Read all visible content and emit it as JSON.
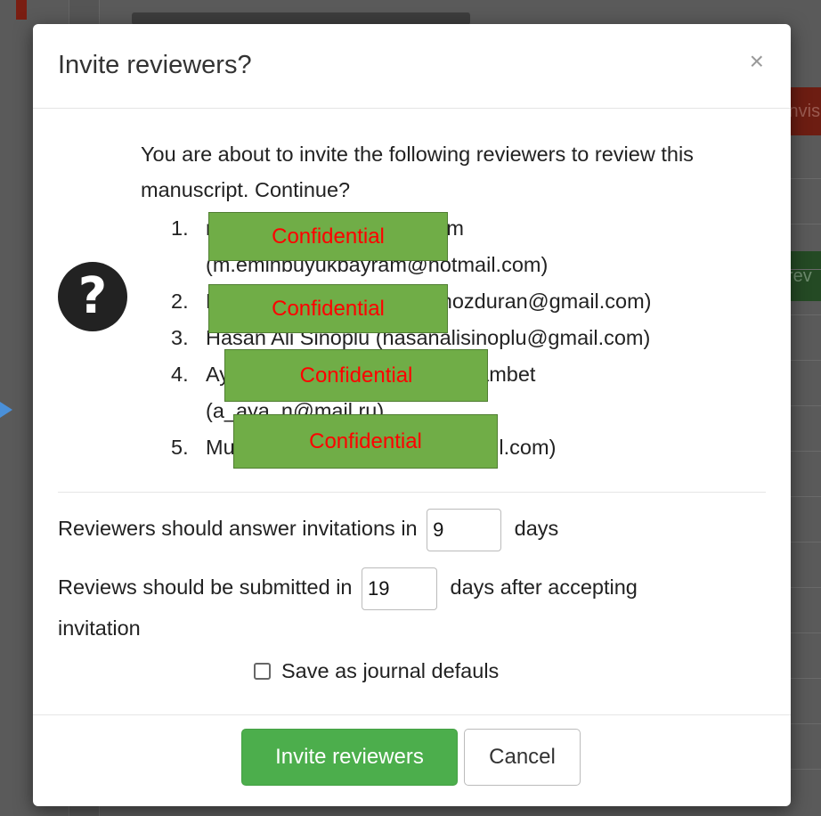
{
  "background": {
    "red_button_label": "Invis",
    "green_button_label": "rev"
  },
  "modal": {
    "title": "Invite reviewers?",
    "close_glyph": "×",
    "question_icon": "question-circle-icon",
    "intro": "You are about to invite the following reviewers to review this manuscript. Continue?",
    "reviewers": [
      {
        "num": "1.",
        "line1": "mehmet emin büyükbayram",
        "line2": "(m.eminbuyukbayram@hotmail.com)"
      },
      {
        "num": "2.",
        "line1": "ERKAN ÖZDURAN (erkanozduran@gmail.com)"
      },
      {
        "num": "3.",
        "line1": "Hasan Ali Sinoplu (hasanalisinoplu@gmail.com)"
      },
      {
        "num": "4.",
        "line1": "Ayaulym Muratkyzy Nurmukhambet",
        "line2": "(a_aya_n@mail.ru)"
      },
      {
        "num": "5.",
        "line1": "Murat Kerk (drmuratkerk@gmail.com)"
      }
    ],
    "redaction_label": "Confidential",
    "answer_label_before": "Reviewers should answer invitations in",
    "answer_days": "9",
    "answer_label_after": "days",
    "submit_label_before": "Reviews should be submitted in",
    "submit_days": "19",
    "submit_label_after": "days after accepting",
    "submit_label_line2": "invitation",
    "save_defaults_label": "Save as journal defauls",
    "invite_button": "Invite reviewers",
    "cancel_button": "Cancel"
  },
  "colors": {
    "invite_button_bg": "#4cae4c",
    "redaction_bg": "#70ad47",
    "redaction_text": "#ff0000",
    "arrow": "#4a90d9"
  }
}
